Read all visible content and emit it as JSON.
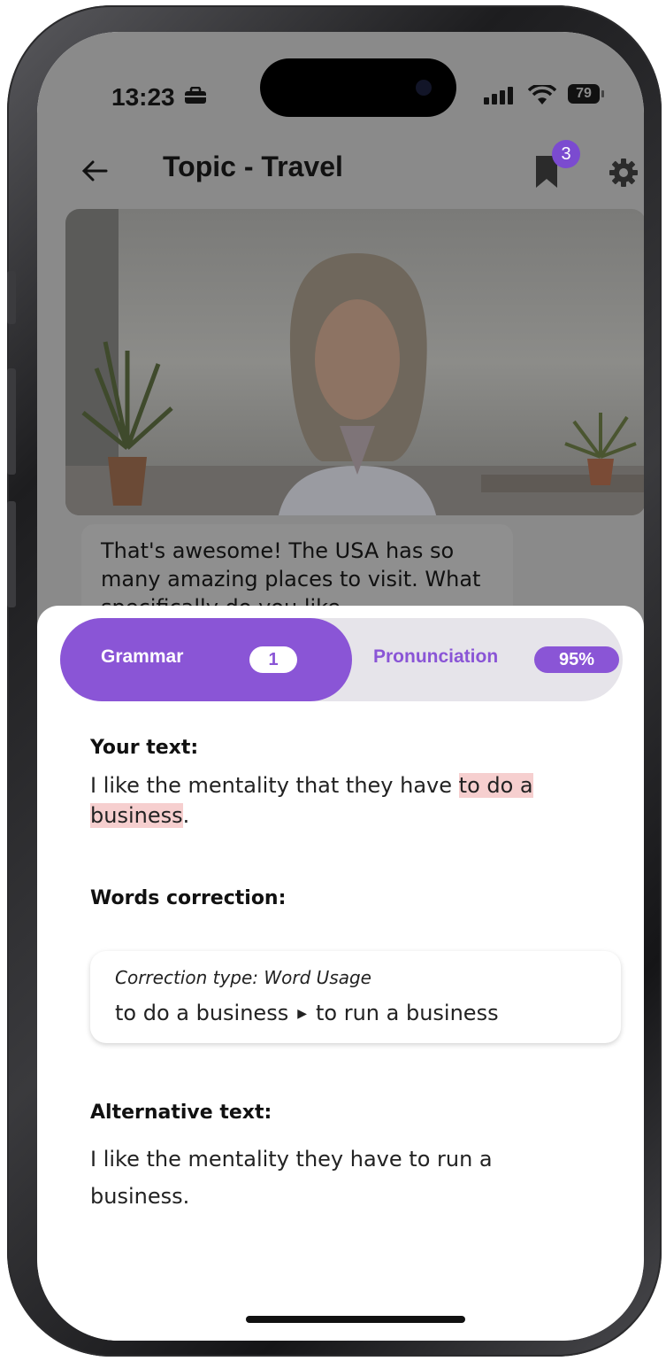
{
  "status_bar": {
    "time": "13:23",
    "battery": "79"
  },
  "header": {
    "title": "Topic - Travel",
    "bookmark_badge": "3"
  },
  "chat": {
    "bubble_text": "That's awesome! The USA has so many amazing places to visit. What specifically do you like"
  },
  "tabs": {
    "grammar_label": "Grammar",
    "grammar_count": "1",
    "pronunciation_label": "Pronunciation",
    "pronunciation_score": "95%"
  },
  "your_text": {
    "heading": "Your text:",
    "before": "I like the mentality that they have ",
    "highlight": "to do a business",
    "after": "."
  },
  "words_correction": {
    "heading": "Words correction:",
    "type_label": "Correction type: Word Usage",
    "from": "to do a business",
    "to": "to run a business"
  },
  "alternative_text": {
    "heading": "Alternative text:",
    "text": "I like the mentality they have to run a business."
  },
  "colors": {
    "accent": "#8a55d6",
    "highlight": "#f6cfcf",
    "dim_overlay": "#8a8a8a"
  },
  "icons": {
    "back": "arrow-left-icon",
    "bookmark": "bookmark-icon",
    "settings": "gear-icon",
    "arrow": "play-arrow-icon"
  }
}
